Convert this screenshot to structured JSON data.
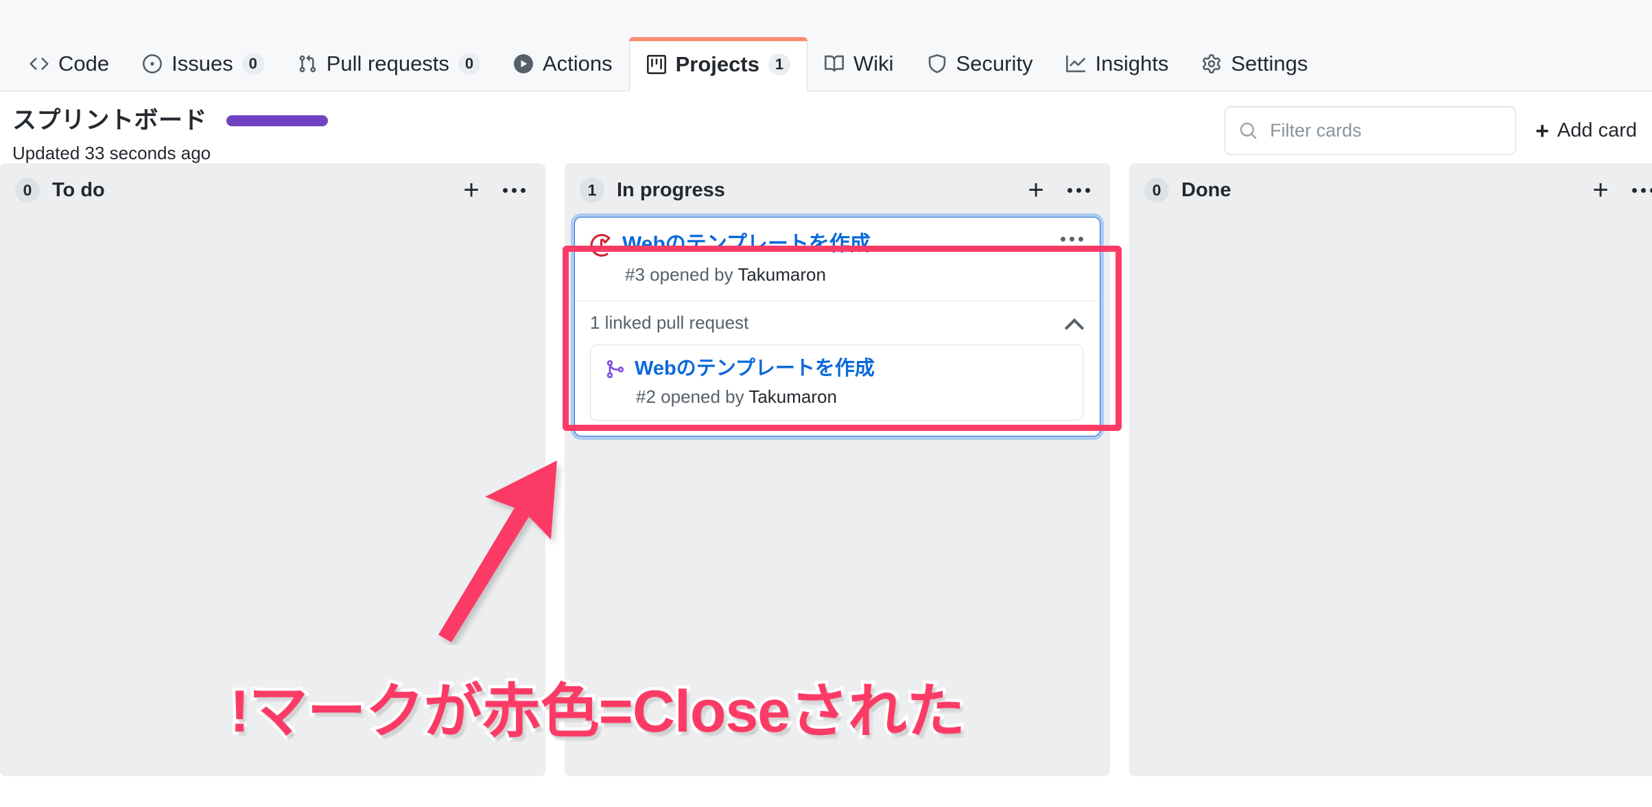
{
  "repo_nav": {
    "tabs": [
      {
        "label": "Code",
        "icon": "code-icon",
        "count": null,
        "active": false
      },
      {
        "label": "Issues",
        "icon": "issue-opened-icon",
        "count": "0",
        "active": false
      },
      {
        "label": "Pull requests",
        "icon": "git-pull-request-icon",
        "count": "0",
        "active": false
      },
      {
        "label": "Actions",
        "icon": "play-icon",
        "count": null,
        "active": false
      },
      {
        "label": "Projects",
        "icon": "project-icon",
        "count": "1",
        "active": true
      },
      {
        "label": "Wiki",
        "icon": "book-icon",
        "count": null,
        "active": false
      },
      {
        "label": "Security",
        "icon": "shield-icon",
        "count": null,
        "active": false
      },
      {
        "label": "Insights",
        "icon": "graph-icon",
        "count": null,
        "active": false
      },
      {
        "label": "Settings",
        "icon": "gear-icon",
        "count": null,
        "active": false
      }
    ],
    "active_tab_accent": "#fd8c73"
  },
  "project_header": {
    "title": "スプリントボード",
    "updated": "Updated 33 seconds ago",
    "progress_color": "#6f42c1",
    "filter": {
      "placeholder": "Filter cards",
      "value": "",
      "icon": "search-icon"
    },
    "add_card_label": "Add card",
    "add_card_icon": "plus-icon"
  },
  "board": {
    "columns": [
      {
        "name": "To do",
        "count": "0",
        "add_icon": "plus-icon",
        "menu_icon": "kebab-horizontal-icon",
        "cards": []
      },
      {
        "name": "In progress",
        "count": "1",
        "add_icon": "plus-icon",
        "menu_icon": "kebab-horizontal-icon",
        "cards": [
          {
            "icon": "issue-closed-icon",
            "icon_color": "#cb2431",
            "title": "Webのテンプレートを作成",
            "meta_number": "#3",
            "meta_text": " opened by ",
            "meta_author": "Takumaron",
            "menu_icon": "kebab-horizontal-icon",
            "linked": {
              "label": "1 linked pull request",
              "collapse_icon": "chevron-up-icon",
              "items": [
                {
                  "icon": "git-merge-icon",
                  "icon_color": "#8250df",
                  "title": "Webのテンプレートを作成",
                  "meta_number": "#2",
                  "meta_text": " opened by ",
                  "meta_author": "Takumaron"
                }
              ]
            }
          }
        ]
      },
      {
        "name": "Done",
        "count": "0",
        "add_icon": "plus-icon",
        "menu_icon": "kebab-horizontal-icon",
        "cards": []
      }
    ]
  },
  "annotation": {
    "text": "!マークが赤色=Closeされた",
    "color": "#fb3b66",
    "outline_color": "#ffffff",
    "highlight_box_color": "#fb3b66",
    "arrow_icon": "arrow-up-right-icon"
  }
}
